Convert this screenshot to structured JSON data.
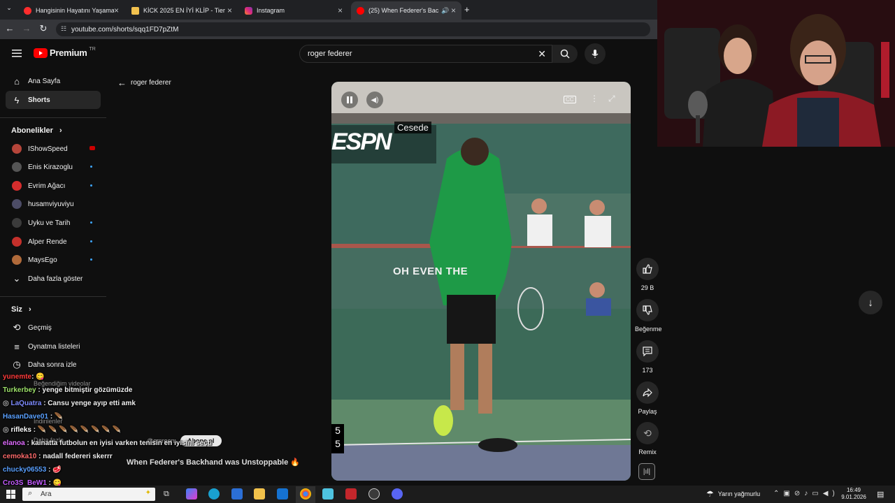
{
  "browser": {
    "tabs": [
      {
        "title": "Hangisinin Hayatını Yaşamak İst",
        "favicon_color": "#ff2d2d"
      },
      {
        "title": "KİCK 2025 EN İYİ KLİP - Tier List",
        "favicon_color": "#f2c14e"
      },
      {
        "title": "Instagram",
        "favicon_color": "#e1306c"
      },
      {
        "title": "(25) When Federer's Backha",
        "favicon_color": "#ff0000"
      }
    ],
    "address": "youtube.com/shorts/sqq1FD7pZtM"
  },
  "youtube": {
    "logo_text": "Premium",
    "logo_badge": "TR",
    "search_value": "roger federer",
    "back_label": "roger federer",
    "nav": [
      {
        "label": "Ana Sayfa",
        "icon": "home-icon"
      },
      {
        "label": "Shorts",
        "icon": "shorts-icon"
      }
    ],
    "subscriptions_title": "Abonelikler",
    "subscriptions": [
      {
        "label": "IShowSpeed",
        "color": "#b5453a",
        "badge": "live"
      },
      {
        "label": "Enis Kirazoglu",
        "color": "#555555",
        "badge": "new"
      },
      {
        "label": "Evrim Ağacı",
        "color": "#d62d2d",
        "badge": "new"
      },
      {
        "label": "husamviyuviyu",
        "color": "#4c4c66",
        "badge": ""
      },
      {
        "label": "Uyku ve Tarih",
        "color": "#3b3b3b",
        "badge": "new"
      },
      {
        "label": "Alper Rende",
        "color": "#c4302b",
        "badge": "new"
      },
      {
        "label": "MaysEgo",
        "color": "#b06a3a",
        "badge": "new"
      }
    ],
    "show_more": "Daha fazla göster",
    "you_title": "Siz",
    "you_items": [
      {
        "label": "Geçmiş",
        "icon": "history-icon"
      },
      {
        "label": "Oynatma listeleri",
        "icon": "playlist-icon"
      },
      {
        "label": "Daha sonra izle",
        "icon": "clock-icon"
      }
    ],
    "overlay_items": {
      "liked": "Beğendiğim videolar",
      "downloads": "İndirilenler",
      "more": "Daha fazla",
      "subscribe": "Abone ol",
      "handle": "@emreen"
    },
    "video": {
      "caption_top": "Cesede",
      "overlay_text": "OH EVEN THE",
      "counter_digits": [
        "5",
        "5"
      ],
      "title": "When Federer's Backhand was Unstoppable 🔥"
    },
    "actions": [
      {
        "icon": "like-icon",
        "label": "29 B"
      },
      {
        "icon": "dislike-icon",
        "label": "Beğenme"
      },
      {
        "icon": "comment-icon",
        "label": "173"
      },
      {
        "icon": "share-icon",
        "label": "Paylaş"
      },
      {
        "icon": "remix-icon",
        "label": "Remix"
      }
    ]
  },
  "chat": [
    {
      "user": "yunemte",
      "user_color": "#ff3b3b",
      "msg": ":  😋"
    },
    {
      "user": "Turkerbey",
      "user_color": "#9fe36b",
      "msg": ": yenge bitmiştir gözümüzde"
    },
    {
      "user": "LaQuatra",
      "user_color": "#7f8cff",
      "msg": ": Cansu yenge ayıp etti amk"
    },
    {
      "user": "HasanDave01",
      "user_color": "#5aa0ff",
      "msg": ":  🪶"
    },
    {
      "user": "rifleks",
      "user_color": "#ffffff",
      "msg": ":  🪶 🪶 🪶 🪶 🪶 🪶 🪶 🪶"
    },
    {
      "user": "elanoa",
      "user_color": "#e06cff",
      "msg": ": kainatta futbolun en iyisi varken tenisin en iyisini seçti"
    },
    {
      "user": "cemoka10",
      "user_color": "#ff6b6b",
      "msg": ": nadall federeri skerrr"
    },
    {
      "user": "chucky06553",
      "user_color": "#5aa0ff",
      "msg": ":  🥩"
    },
    {
      "user": "Cro3S_BeW1",
      "user_color": "#c45cff",
      "msg": ":  😋"
    }
  ],
  "taskbar": {
    "search_placeholder": "Ara",
    "weather": "Yarın yağmurlu",
    "time": "16:49",
    "date": "9.01.2026"
  }
}
